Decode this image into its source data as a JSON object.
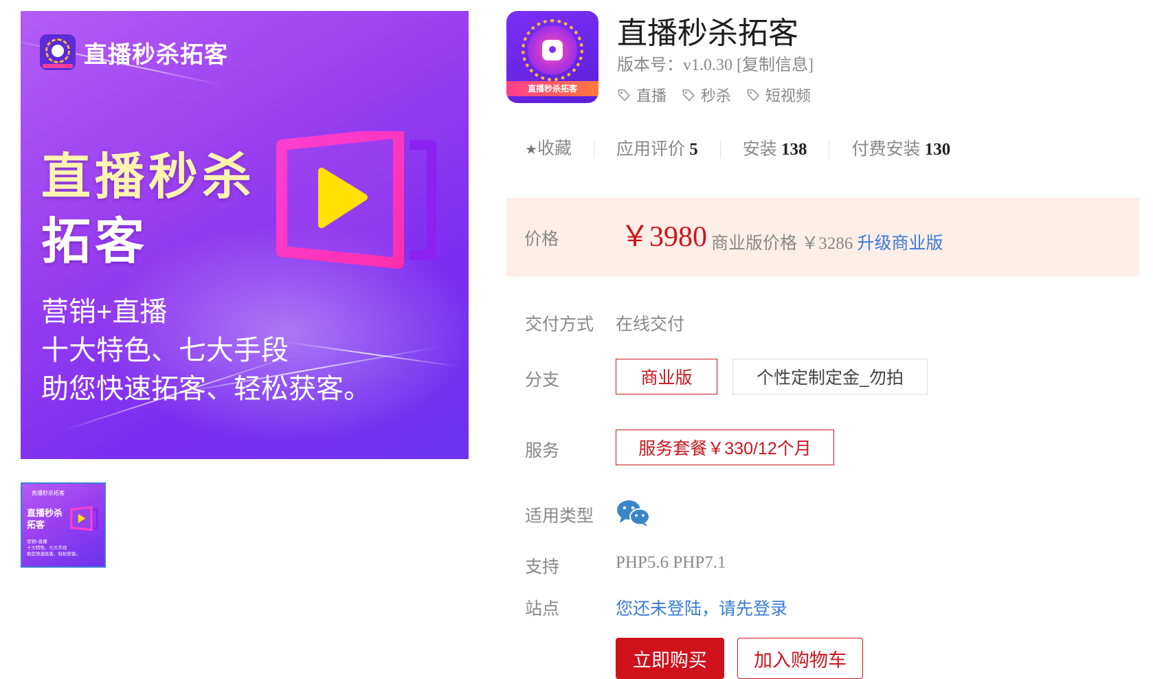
{
  "banner": {
    "brand": "直播秒杀拓客",
    "title_line1": "直播秒杀",
    "title_line2": "拓客",
    "sub_lines": [
      "营销+直播",
      "十大特色、七大手段",
      "助您快速拓客、轻松获客。"
    ]
  },
  "thumbnail": {
    "brand": "直播秒杀拓客",
    "title_line1": "直播秒杀",
    "title_line2": "拓客",
    "sub_lines": [
      "营销+直播",
      "十大特色、七大手段",
      "助您快速拓客、轻松获客。"
    ]
  },
  "app": {
    "icon_text": "直播秒杀拓客",
    "name": "直播秒杀拓客",
    "version_label": "版本号：",
    "version": "v1.0.30",
    "copy_info": "[复制信息]",
    "tags": [
      "直播",
      "秒杀",
      "短视频"
    ]
  },
  "stats": {
    "favorite_label": "收藏",
    "rating_label": "应用评价",
    "rating_value": "5",
    "install_label": "安装",
    "install_value": "138",
    "paid_install_label": "付费安装",
    "paid_install_value": "130"
  },
  "price": {
    "label": "价格",
    "value": "￥3980",
    "business_label": "商业版价格",
    "business_value": "￥3286",
    "upgrade_link": "升级商业版"
  },
  "details": {
    "delivery_label": "交付方式",
    "delivery_value": "在线交付",
    "branch_label": "分支",
    "branch_options": [
      "商业版",
      "个性定制定金_勿拍"
    ],
    "service_label": "服务",
    "service_option": "服务套餐￥330/12个月",
    "type_label": "适用类型",
    "type_icon": "wechat-icon",
    "support_label": "支持",
    "support_value": "PHP5.6 PHP7.1",
    "site_label": "站点",
    "site_value": "您还未登陆，请先登录"
  },
  "actions": {
    "buy_now": "立即购买",
    "add_to_cart": "加入购物车"
  },
  "colors": {
    "accent_red": "#d0121b",
    "link_blue": "#3a7bd5",
    "price_bg": "#fdeee8",
    "banner_purple": "#9a3ff0"
  }
}
